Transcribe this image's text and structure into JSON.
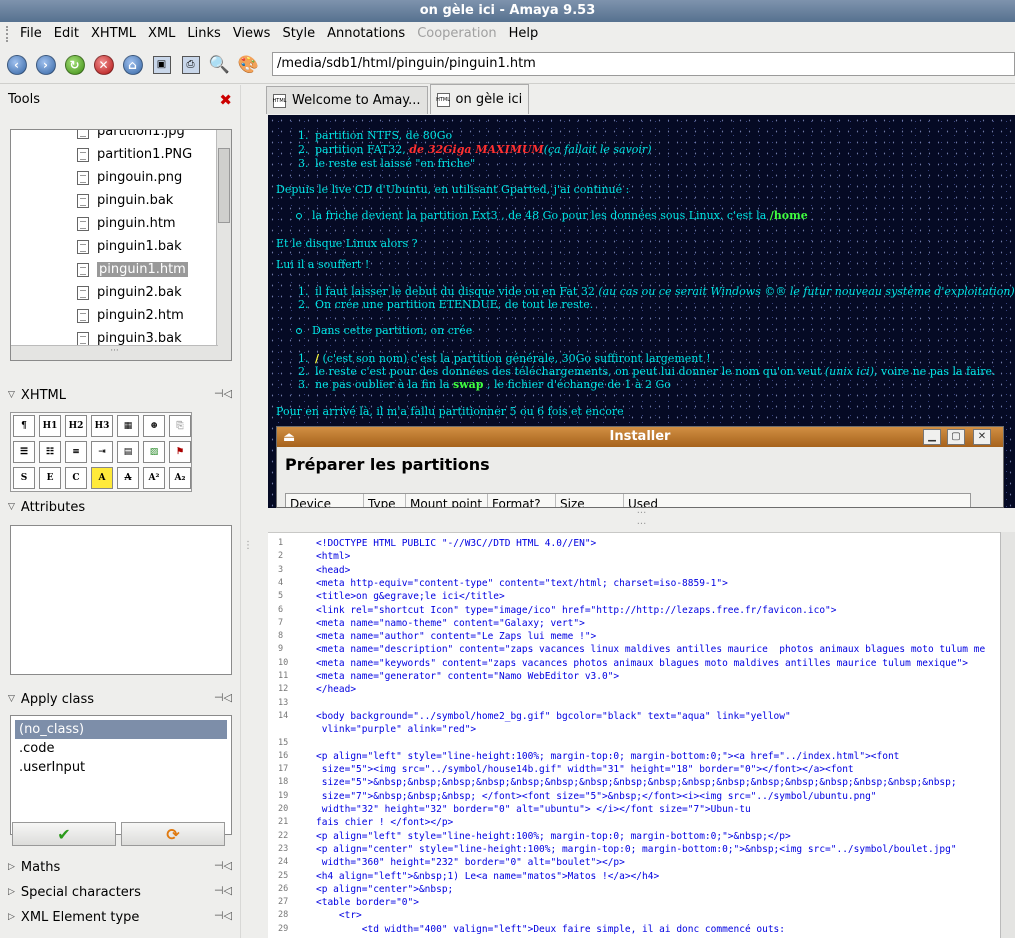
{
  "window": {
    "title": "on gèle ici - Amaya 9.53"
  },
  "menu": [
    "File",
    "Edit",
    "XHTML",
    "XML",
    "Links",
    "Views",
    "Style",
    "Annotations",
    "Cooperation",
    "Help"
  ],
  "address": {
    "url": "/media/sdb1/html/pinguin/pinguin1.htm"
  },
  "tools": {
    "title": "Tools",
    "files": [
      "partition1.jpg",
      "partition1.PNG",
      "pingouin.png",
      "pinguin.bak",
      "pinguin.htm",
      "pinguin1.bak",
      "pinguin1.htm",
      "pinguin2.bak",
      "pinguin2.htm",
      "pinguin3.bak"
    ],
    "selected_file": "pinguin1.htm"
  },
  "panels": {
    "xhtml": "XHTML",
    "attributes": "Attributes",
    "apply_class": "Apply class",
    "maths": "Maths",
    "special_characters": "Special characters",
    "xml_element_type": "XML Element type"
  },
  "xhtml_buttons": [
    "",
    "H1",
    "H2",
    "H3",
    "",
    "",
    "",
    "",
    "",
    "",
    "",
    "",
    "",
    "",
    "S",
    "E",
    "C",
    "A",
    "A",
    "A²",
    "A₂"
  ],
  "classes": [
    "(no_class)",
    ".code",
    ".userInput"
  ],
  "tabs": [
    "Welcome to Amay...",
    "on gèle ici"
  ],
  "page": {
    "list1": [
      "partition NTFS,  de 80Go",
      "partition FAT32, ",
      "le reste est laissé \"en friche\""
    ],
    "list1_red": "de 32Giga MAXIMUM",
    "list1_italic": "(ça fallait le savoir)",
    "p1": "Depuis le live CD d'Ubuntu, en utilisant Gparted, j'ai continué :",
    "b1": "la friche devient la partition Ext3 ,  de 48 Go pour les données sous Linux. c'est la ",
    "b1_green": "/home",
    "p2": "Et le disque Linux alors ?",
    "p3": "Lui il a souffert !",
    "list2_1": "il faut laisser le debut du disque vide ou en Fat 32 ",
    "list2_1_italic": "(au cas ou ce serait Windows ©®  le futur nouveau système d'exploitation) 40Go suffiront ils ?",
    "list2_2": "On crée une partition ETENDUE, de tout le reste.",
    "b2": "Dans cette partition, on crée",
    "list3_1_yellow": "/",
    "list3_1": "  (c'est son nom) c'est la partition générale, 30Go suffiront largement !",
    "list3_2": "le reste c'est pour des données des téléchargements, on peut lui donner le nom qu'on veut ",
    "list3_2_italic": "(unix ici)",
    "list3_2_end": ", voire ne pas la faire.",
    "list3_3": "ne pas oublier à la fin la ",
    "list3_3_green": "swap",
    "list3_3_end": " , le fichier d'échange de 1 à 2 Go",
    "p4": "Pour en arrivé là, il m'a fallu partitionner 5 ou 6 fois et encore"
  },
  "installer": {
    "title": "Installer",
    "heading": "Préparer les partitions",
    "columns": [
      "Device",
      "Type",
      "Mount point",
      "Format?",
      "Size",
      "Used"
    ]
  },
  "source": [
    "<!DOCTYPE HTML PUBLIC \"-//W3C//DTD HTML 4.0//EN\">",
    "<html>",
    "<head>",
    "<meta http-equiv=\"content-type\" content=\"text/html; charset=iso-8859-1\">",
    "<title>on g&egrave;le ici</title>",
    "<link rel=\"shortcut Icon\" type=\"image/ico\" href=\"http://http://lezaps.free.fr/favicon.ico\">",
    "<meta name=\"namo-theme\" content=\"Galaxy; vert\">",
    "<meta name=\"author\" content=\"Le Zaps lui meme !\">",
    "<meta name=\"description\" content=\"zaps vacances linux maldives antilles maurice  photos animaux blagues moto tulum me",
    "<meta name=\"keywords\" content=\"zaps vacances photos animaux blagues moto maldives antilles maurice tulum mexique\">",
    "<meta name=\"generator\" content=\"Namo WebEditor v3.0\">",
    "</head>",
    "",
    "<body background=\"../symbol/home2_bg.gif\" bgcolor=\"black\" text=\"aqua\" link=\"yellow\"",
    " vlink=\"purple\" alink=\"red\">",
    "",
    "<p align=\"left\" style=\"line-height:100%; margin-top:0; margin-bottom:0;\"><a href=\"../index.html\"><font",
    " size=\"5\"><img src=\"../symbol/house14b.gif\" width=\"31\" height=\"18\" border=\"0\"></font></a><font",
    " size=\"5\">&nbsp;&nbsp;&nbsp;&nbsp;&nbsp;&nbsp;&nbsp;&nbsp;&nbsp;&nbsp;&nbsp;&nbsp;&nbsp;&nbsp;&nbsp;&nbsp;&nbsp;",
    " size=\"7\">&nbsp;&nbsp;&nbsp; </font><font size=\"5\">&nbsp;</font><i><img src=\"../symbol/ubuntu.png\"",
    " width=\"32\" height=\"32\" border=\"0\" alt=\"ubuntu\"> </i></font size=\"7\">Ubun-tu",
    "fais chier ! </font></p>",
    "<p align=\"left\" style=\"line-height:100%; margin-top:0; margin-bottom:0;\">&nbsp;</p>",
    "<p align=\"center\" style=\"line-height:100%; margin-top:0; margin-bottom:0;\">&nbsp;<img src=\"../symbol/boulet.jpg\"",
    " width=\"360\" height=\"232\" border=\"0\" alt=\"boulet\"></p>",
    "<h4 align=\"left\">&nbsp;1) Le<a name=\"matos\">Matos !</a></h4>",
    "<p align=\"center\">&nbsp;",
    "<table border=\"0\">",
    "    <tr>",
    "        <td width=\"400\" valign=\"left\">Deux faire simple, il ai donc commencé outs:"
  ],
  "source_line_numbers": [
    "1",
    "2",
    "3",
    "4",
    "5",
    "6",
    "7",
    "8",
    "9",
    "10",
    "11",
    "12",
    "13",
    "14",
    "",
    "15",
    "16",
    "17",
    "18",
    "19",
    "20",
    "21",
    "22",
    "23",
    "24",
    "25",
    "26",
    "27",
    "28",
    "29"
  ]
}
